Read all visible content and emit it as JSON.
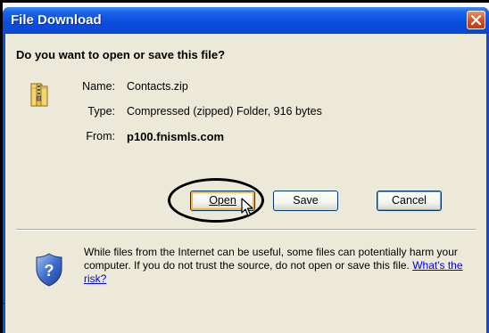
{
  "window": {
    "title": "File Download"
  },
  "dialog": {
    "question": "Do you want to open or save this file?",
    "fields": {
      "name_label": "Name:",
      "name_value": "Contacts.zip",
      "type_label": "Type:",
      "type_value": "Compressed (zipped) Folder, 916 bytes",
      "from_label": "From:",
      "from_value": "p100.fnismls.com"
    },
    "buttons": {
      "open": "Open",
      "save": "Save",
      "cancel": "Cancel"
    },
    "warning_text": "While files from the Internet can be useful, some files can potentially harm your computer. If you do not trust the source, do not open or save this file.",
    "risk_link": "What's the risk?"
  },
  "icons": {
    "title_close": "close-icon",
    "file": "zip-folder-icon",
    "security": "shield-question-icon",
    "cursor": "mouse-pointer-icon"
  },
  "colors": {
    "titlebar": "#0a4ee0",
    "client_bg": "#ece9d8",
    "close_button": "#d4521f",
    "link": "#0000ff",
    "focus_highlight": "#f8b33f"
  }
}
